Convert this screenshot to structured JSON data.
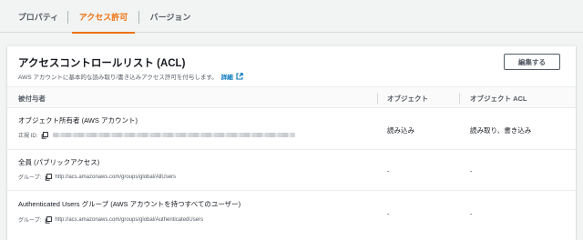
{
  "tabs": [
    {
      "label": "プロパティ",
      "active": false
    },
    {
      "label": "アクセス許可",
      "active": true
    },
    {
      "label": "バージョン",
      "active": false
    }
  ],
  "acl": {
    "title": "アクセスコントロールリスト (ACL)",
    "description": "AWS アカウントに基本的な読み取り/書き込みアクセス許可を付与します。",
    "details_link": "詳細",
    "edit_button": "編集する",
    "columns": {
      "grantee": "被付与者",
      "objects": "オブジェクト",
      "object_acl": "オブジェクト ACL"
    },
    "rows": [
      {
        "grantee": "オブジェクト所有者 (AWS アカウント)",
        "sub_label": "正規 ID:",
        "sub_value": "",
        "objects": "読み込み",
        "object_acl": "読み取り、書き込み"
      },
      {
        "grantee": "全員 (パブリックアクセス)",
        "sub_label": "グループ:",
        "sub_value": "http://acs.amazonaws.com/groups/global/AllUsers",
        "objects": "-",
        "object_acl": "-"
      },
      {
        "grantee": "Authenticated Users グループ (AWS アカウントを持つすべてのユーザー)",
        "sub_label": "グループ:",
        "sub_value": "http://acs.amazonaws.com/groups/global/AuthenticatedUsers",
        "objects": "-",
        "object_acl": "-"
      }
    ]
  },
  "colors": {
    "accent": "#ec7211",
    "link": "#0073bb",
    "text": "#16191f",
    "muted": "#545b64"
  },
  "icons": [
    "external-link-icon",
    "copy-icon"
  ]
}
